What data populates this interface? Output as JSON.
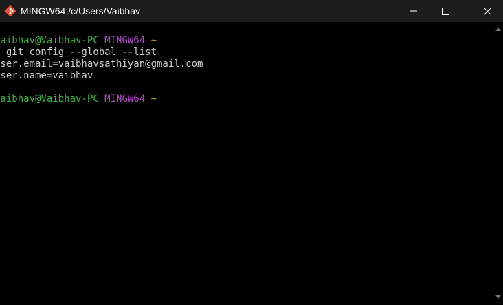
{
  "window": {
    "title": "MINGW64:/c/Users/Vaibhav"
  },
  "title_icon": "git-bash-icon",
  "caption_buttons": [
    "minimize-icon",
    "maximize-icon",
    "close-icon"
  ],
  "terminal": {
    "prompt1": {
      "user_host": "Vaibhav@Vaibhav-PC",
      "env": "MINGW64",
      "path": "~"
    },
    "command": "$ git config --global --list",
    "output": [
      "user.email=vaibhavsathiyan@gmail.com",
      "user.name=vaibhav"
    ],
    "prompt2": {
      "user_host": "Vaibhav@Vaibhav-PC",
      "env": "MINGW64",
      "path": "~"
    },
    "cursor_line": "$"
  },
  "colors": {
    "user_host": "#3cb043",
    "env": "#b148c6",
    "path": "#c1a21e",
    "text": "#cccccc",
    "background": "#000000",
    "titlebar": "#1c1c1c"
  }
}
